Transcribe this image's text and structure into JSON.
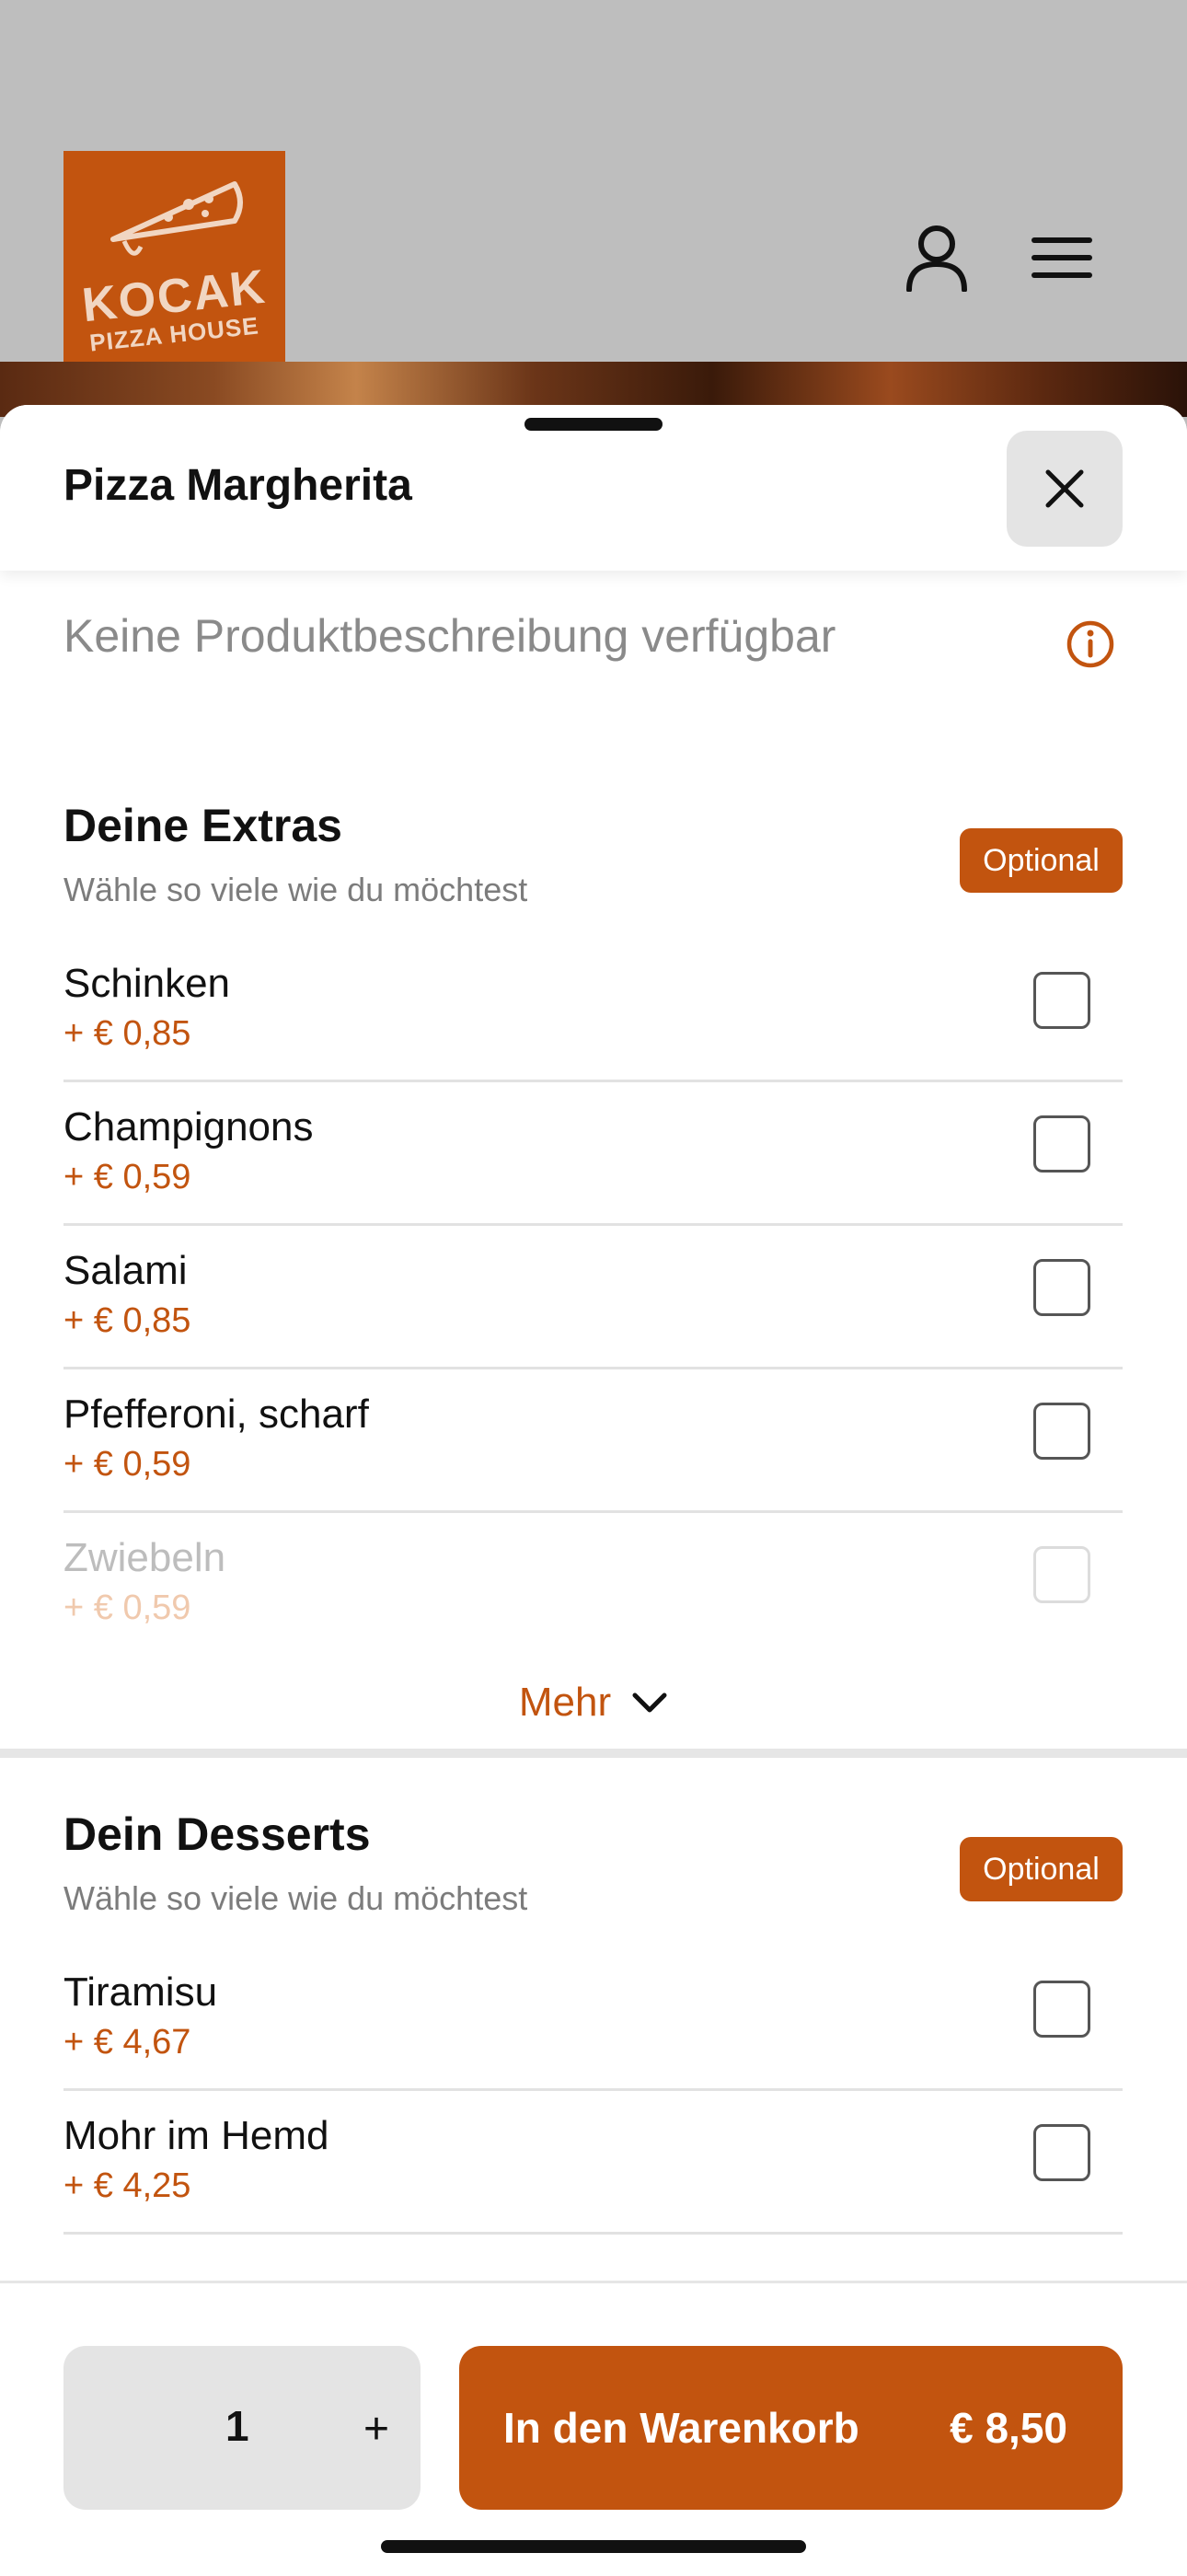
{
  "brand": {
    "name": "KOCAK",
    "subtitle": "PIZZA HOUSE",
    "color": "#c2540f"
  },
  "header": {
    "icons": [
      "user-icon",
      "menu-icon"
    ]
  },
  "product": {
    "title": "Pizza Margherita",
    "description": "Keine Produktbeschreibung verfügbar"
  },
  "groups": [
    {
      "title": "Deine Extras",
      "subtitle": "Wähle so viele wie du möchtest",
      "badge": "Optional",
      "items": [
        {
          "name": "Schinken",
          "price": "+ € 0,85"
        },
        {
          "name": "Champignons",
          "price": "+ € 0,59"
        },
        {
          "name": "Salami",
          "price": "+ € 0,85"
        },
        {
          "name": "Pfefferoni, scharf",
          "price": "+ € 0,59"
        },
        {
          "name": "Zwiebeln",
          "price": "+ € 0,59"
        }
      ],
      "more_label": "Mehr"
    },
    {
      "title": "Dein Desserts",
      "subtitle": "Wähle so viele wie du möchtest",
      "badge": "Optional",
      "items": [
        {
          "name": "Tiramisu",
          "price": "+ € 4,67"
        },
        {
          "name": "Mohr im Hemd",
          "price": "+ € 4,25"
        }
      ]
    }
  ],
  "footer": {
    "quantity": "1",
    "plus": "+",
    "cart_label": "In den Warenkorb",
    "total": "€ 8,50"
  }
}
